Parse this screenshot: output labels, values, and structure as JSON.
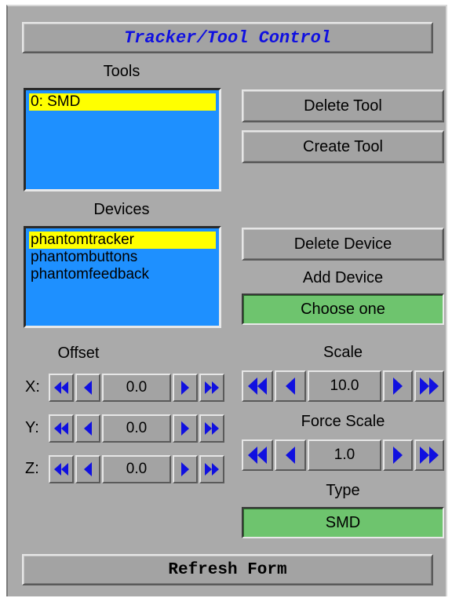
{
  "title": "Tracker/Tool Control",
  "tools": {
    "label": "Tools",
    "items": [
      "0: SMD"
    ],
    "selected_index": 0,
    "delete_label": "Delete Tool",
    "create_label": "Create Tool"
  },
  "devices": {
    "label": "Devices",
    "items": [
      "phantomtracker",
      "phantombuttons",
      "phantomfeedback"
    ],
    "selected_index": 0,
    "delete_label": "Delete Device",
    "add_label": "Add Device",
    "add_choice": "Choose one"
  },
  "offset": {
    "label": "Offset",
    "x_label": "X:",
    "x_value": "0.0",
    "y_label": "Y:",
    "y_value": "0.0",
    "z_label": "Z:",
    "z_value": "0.0"
  },
  "scale": {
    "label": "Scale",
    "value": "10.0"
  },
  "force_scale": {
    "label": "Force Scale",
    "value": "1.0"
  },
  "type": {
    "label": "Type",
    "value": "SMD"
  },
  "refresh_label": "Refresh Form",
  "colors": {
    "panel": "#aaaaaa",
    "list_bg": "#1e90ff",
    "selection": "#ffff00",
    "green": "#6ec46e",
    "arrow": "#1010e0",
    "title_text": "#1010e0"
  }
}
